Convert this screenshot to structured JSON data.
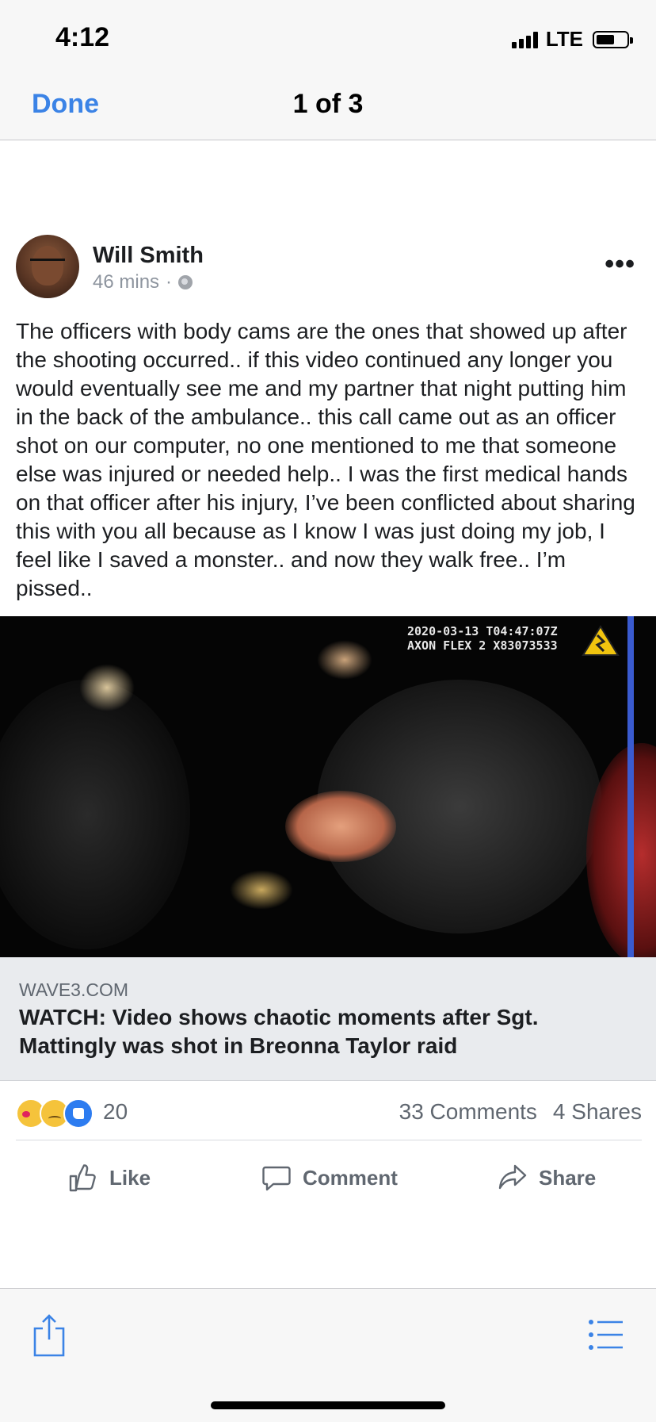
{
  "status_bar": {
    "time": "4:12",
    "network": "LTE",
    "signal_icon": "cellular-signal-icon",
    "battery_icon": "battery-icon"
  },
  "nav": {
    "done_label": "Done",
    "title": "1 of 3"
  },
  "post": {
    "author": "Will Smith",
    "timestamp": "46 mins",
    "separator": "·",
    "privacy_icon": "globe-icon",
    "more_icon": "more-options-icon",
    "text": "The officers with body cams are the ones that showed up after the shooting occurred.. if this video continued any longer you would eventually see me and my partner that night putting him in the back of the ambulance.. this call came out as an officer shot on our computer, no one mentioned to me that someone else was injured or needed help.. I was the first medical hands on that officer after his injury, I’ve been conflicted about sharing this with you all because as I know I was just doing my job, I feel like I saved a monster.. and now they walk free.. I’m pissed.."
  },
  "video": {
    "timestamp_overlay": "2020-03-13 T04:47:07Z",
    "device_overlay": "AXON FLEX 2 X83073533"
  },
  "link_preview": {
    "domain": "WAVE3.COM",
    "title": "WATCH: Video shows chaotic moments after Sgt. Mattingly was shot in Breonna Taylor raid"
  },
  "engagement": {
    "reaction_count": "20",
    "comments": "33 Comments",
    "shares": "4 Shares"
  },
  "actions": {
    "like": "Like",
    "comment": "Comment",
    "share": "Share"
  },
  "colors": {
    "accent": "#3b83e6",
    "muted_text": "#606770",
    "preview_bg": "#e9ebee"
  }
}
